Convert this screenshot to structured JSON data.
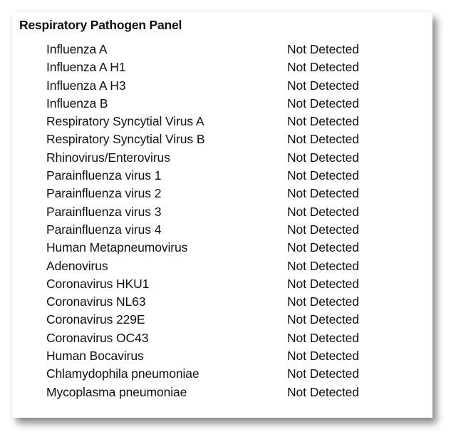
{
  "panel": {
    "title": "Respiratory Pathogen Panel",
    "rows": [
      {
        "pathogen": "Influenza A",
        "result": "Not Detected"
      },
      {
        "pathogen": "Influenza A H1",
        "result": "Not Detected"
      },
      {
        "pathogen": "Influenza A H3",
        "result": "Not Detected"
      },
      {
        "pathogen": "Influenza B",
        "result": "Not Detected"
      },
      {
        "pathogen": "Respiratory Syncytial Virus A",
        "result": "Not Detected"
      },
      {
        "pathogen": "Respiratory Syncytial Virus B",
        "result": "Not Detected"
      },
      {
        "pathogen": "Rhinovirus/Enterovirus",
        "result": "Not Detected"
      },
      {
        "pathogen": "Parainfluenza virus 1",
        "result": "Not Detected"
      },
      {
        "pathogen": "Parainfluenza virus 2",
        "result": "Not Detected"
      },
      {
        "pathogen": "Parainfluenza virus 3",
        "result": "Not Detected"
      },
      {
        "pathogen": "Parainfluenza virus 4",
        "result": "Not Detected"
      },
      {
        "pathogen": "Human Metapneumovirus",
        "result": "Not Detected"
      },
      {
        "pathogen": "Adenovirus",
        "result": "Not Detected"
      },
      {
        "pathogen": "Coronavirus HKU1",
        "result": "Not Detected"
      },
      {
        "pathogen": "Coronavirus NL63",
        "result": "Not Detected"
      },
      {
        "pathogen": "Coronavirus 229E",
        "result": "Not Detected"
      },
      {
        "pathogen": "Coronavirus OC43",
        "result": "Not Detected"
      },
      {
        "pathogen": "Human Bocavirus",
        "result": "Not Detected"
      },
      {
        "pathogen": "Chlamydophila pneumoniae",
        "result": "Not Detected"
      },
      {
        "pathogen": "Mycoplasma pneumoniae",
        "result": "Not Detected"
      }
    ]
  }
}
